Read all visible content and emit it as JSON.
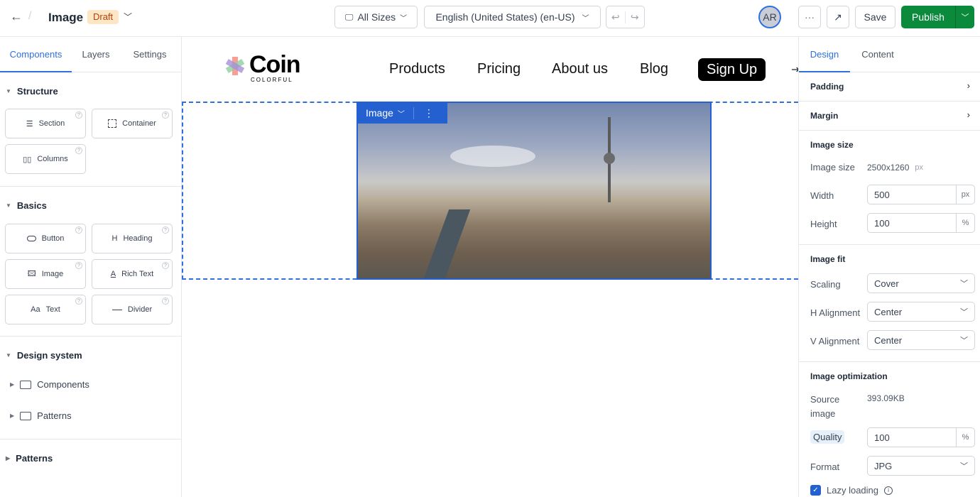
{
  "header": {
    "title": "Image",
    "status": "Draft",
    "sizes": "All Sizes",
    "locale": "English (United States) (en-US)",
    "avatar": "AR",
    "save": "Save",
    "publish": "Publish",
    "more": "···"
  },
  "left": {
    "tabs": [
      "Components",
      "Layers",
      "Settings"
    ],
    "structure": {
      "title": "Structure",
      "items": [
        "Section",
        "Container",
        "Columns"
      ]
    },
    "basics": {
      "title": "Basics",
      "items": [
        "Button",
        "Heading",
        "Image",
        "Rich Text",
        "Text",
        "Divider"
      ]
    },
    "design_system": {
      "title": "Design system",
      "folders": [
        "Components",
        "Patterns"
      ]
    },
    "patterns": {
      "title": "Patterns"
    }
  },
  "canvas": {
    "logo": "Coin",
    "logo_sub": "COLORFUL",
    "nav": [
      "Products",
      "Pricing",
      "About us",
      "Blog"
    ],
    "cta": "Sign Up",
    "selection_label": "Image"
  },
  "right": {
    "tabs": [
      "Design",
      "Content"
    ],
    "padding": "Padding",
    "margin": "Margin",
    "image_size": {
      "title": "Image size",
      "size_label": "Image size",
      "size_value": "2500x1260",
      "size_unit": "px",
      "width_label": "Width",
      "width": "500",
      "width_unit": "px",
      "height_label": "Height",
      "height": "100",
      "height_unit": "%"
    },
    "image_fit": {
      "title": "Image fit",
      "scaling_label": "Scaling",
      "scaling": "Cover",
      "h_label": "H Alignment",
      "h": "Center",
      "v_label": "V Alignment",
      "v": "Center"
    },
    "optimization": {
      "title": "Image optimization",
      "source_label": "Source image",
      "source": "393.09KB",
      "quality_label": "Quality",
      "quality": "100",
      "quality_unit": "%",
      "format_label": "Format",
      "format": "JPG",
      "lazy_label": "Lazy loading",
      "lazy_checked": true
    }
  },
  "colors": {
    "accent": "#2f6fde",
    "publish": "#0b8a3c",
    "draft_bg": "#fde6c4",
    "draft_text": "#b4400e",
    "selection": "#2460d0"
  }
}
